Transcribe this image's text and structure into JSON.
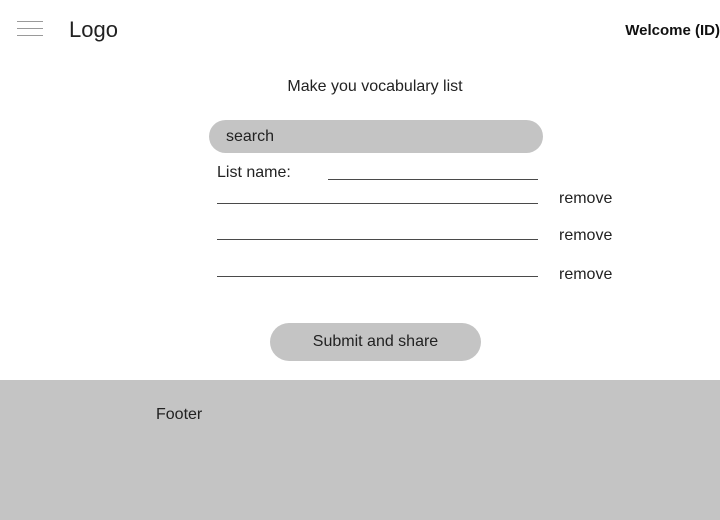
{
  "header": {
    "logo": "Logo",
    "welcome": "Welcome (ID)"
  },
  "main": {
    "title": "Make you vocabulary list",
    "search_value": "search",
    "list_name_label": "List name:",
    "rows": [
      {
        "remove_label": "remove"
      },
      {
        "remove_label": "remove"
      },
      {
        "remove_label": "remove"
      }
    ],
    "submit_label": "Submit and share"
  },
  "footer": {
    "label": "Footer"
  },
  "colors": {
    "pill_gray": "#c4c4c4",
    "footer_gray": "#c4c4c4",
    "text": "#222222"
  }
}
